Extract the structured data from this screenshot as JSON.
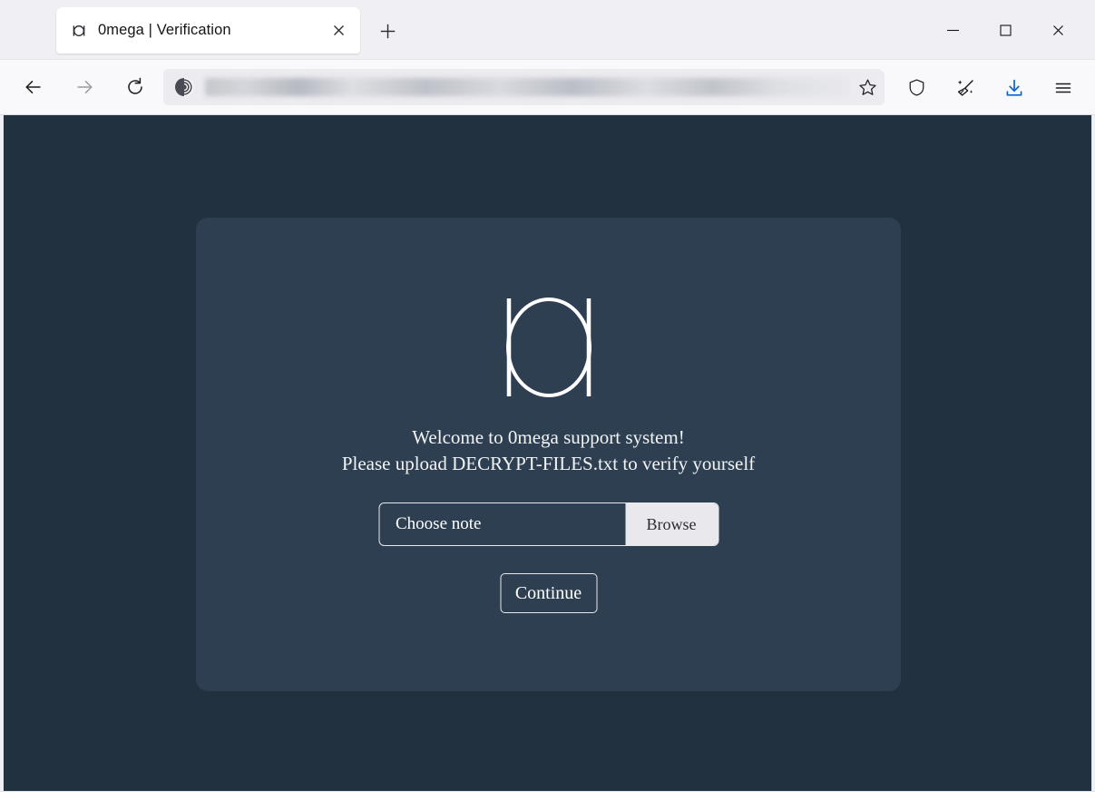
{
  "browser": {
    "tab": {
      "favicon": "omega-logo-icon",
      "title": "0mega | Verification",
      "close_label": "×"
    },
    "new_tab_label": "+",
    "window_controls": {
      "minimize": "minimize-icon",
      "maximize": "maximize-icon",
      "close": "close-icon"
    },
    "nav": {
      "back": "back-arrow-icon",
      "forward": "forward-arrow-icon",
      "reload": "reload-icon"
    },
    "urlbar": {
      "site_icon": "onion-icon",
      "value": "",
      "placeholder": "",
      "state": "blurred"
    },
    "toolbar_icons": [
      {
        "name": "bookmark-star-icon",
        "label": "Bookmark this page"
      },
      {
        "name": "shield-icon",
        "label": "Security level"
      },
      {
        "name": "new-identity-broom-icon",
        "label": "New identity"
      },
      {
        "name": "downloads-icon",
        "label": "Downloads"
      },
      {
        "name": "app-menu-icon",
        "label": "Open application menu"
      }
    ]
  },
  "page": {
    "logo_name": "omega-logo",
    "heading_line1": "Welcome to 0mega support system!",
    "heading_line2": "Please upload DECRYPT-FILES.txt to verify yourself",
    "file_input": {
      "value": "Choose note",
      "browse_label": "Browse"
    },
    "continue_label": "Continue"
  },
  "colors": {
    "page_background": "#22313f",
    "card_background": "#2e3f52",
    "text": "#f2f4f6",
    "browse_button": "#e9e9ed",
    "download_accent": "#0a65d0"
  }
}
